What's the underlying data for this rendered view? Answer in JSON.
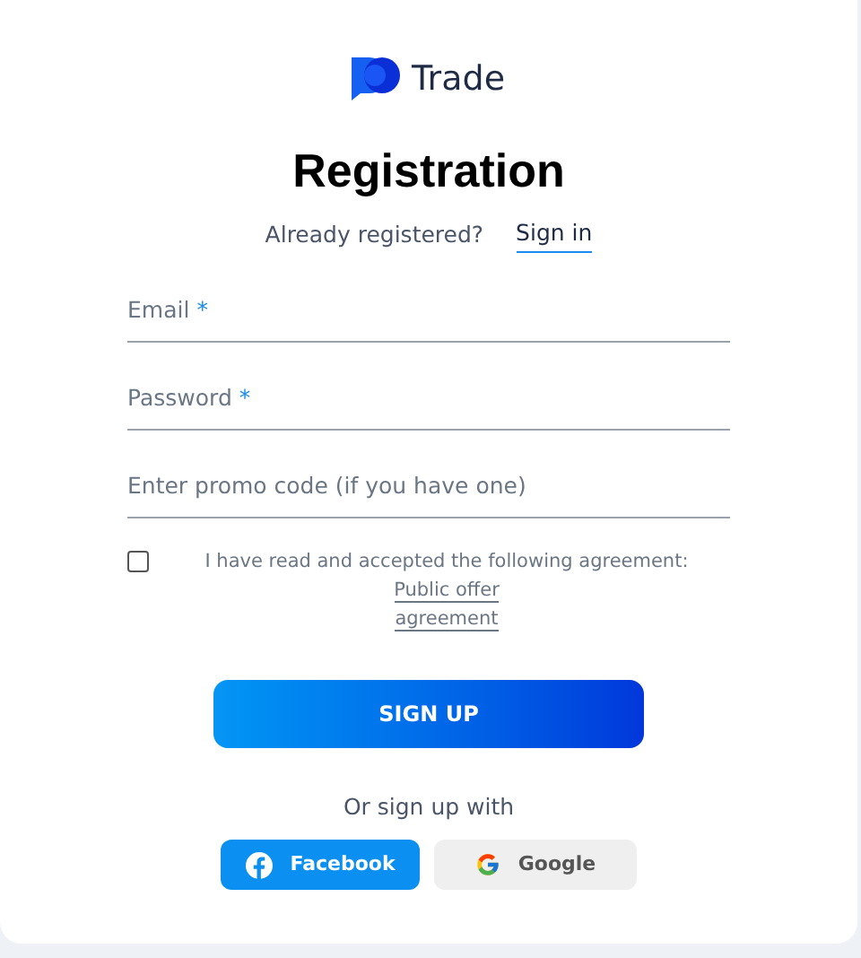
{
  "logo": {
    "text": "Trade"
  },
  "title": "Registration",
  "signin_prompt": {
    "text": "Already registered?",
    "link": "Sign in"
  },
  "fields": [
    {
      "placeholder": "Email",
      "required_mark": "*"
    },
    {
      "placeholder": "Password",
      "required_mark": "*"
    },
    {
      "placeholder": "Enter promo code (if you have one)"
    }
  ],
  "agreement": {
    "checked": false,
    "text": "I have read and accepted the following agreement:",
    "link_1": "Public offer",
    "link_2": "agreement"
  },
  "submit": "SIGN UP",
  "social": {
    "caption": "Or sign up with",
    "buttons": [
      {
        "kind": "facebook",
        "label": "Facebook"
      },
      {
        "kind": "google",
        "label": "Google"
      }
    ]
  }
}
